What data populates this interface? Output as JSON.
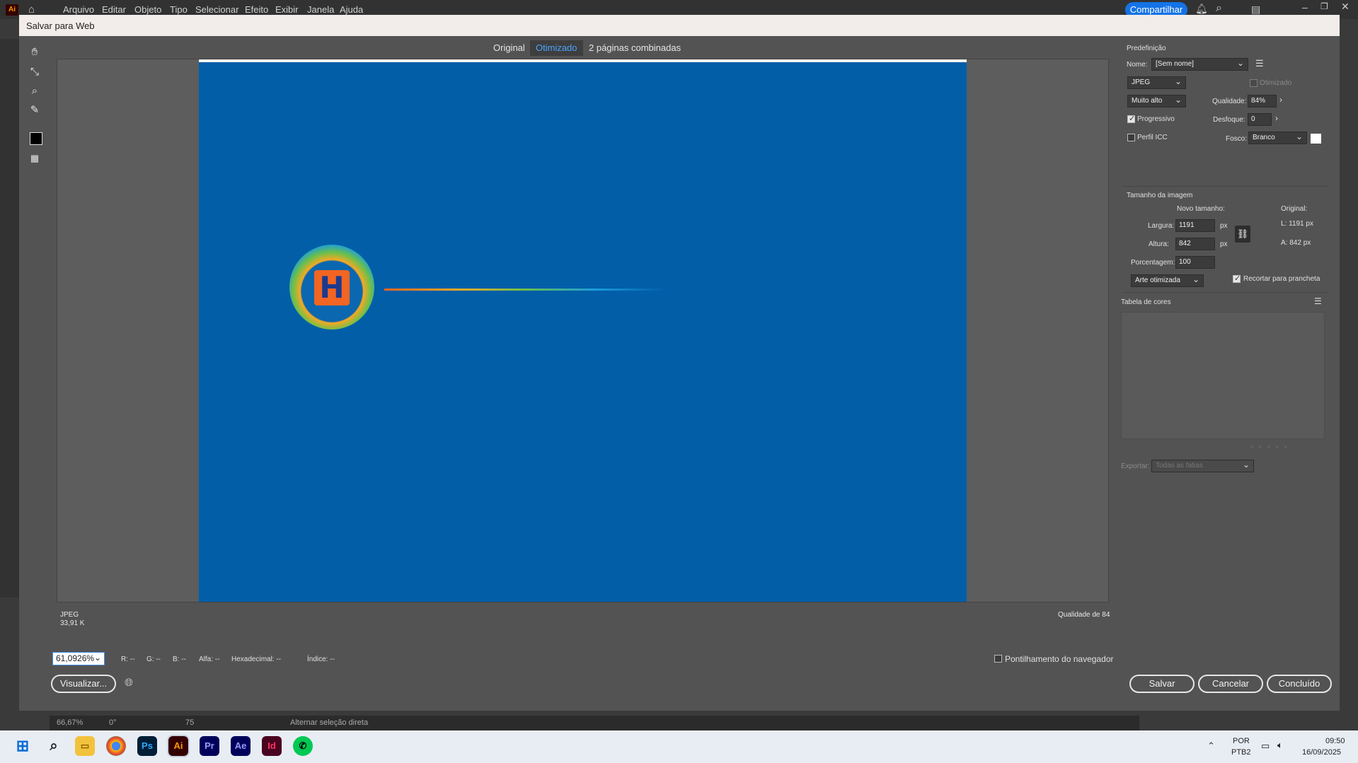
{
  "app": {
    "logo": "Ai",
    "menu": [
      "Arquivo",
      "Editar",
      "Objeto",
      "Tipo",
      "Selecionar",
      "Efeito",
      "Exibir",
      "Janela",
      "Ajuda"
    ],
    "share_label": "Compartilhar"
  },
  "dialog": {
    "title": "Salvar para Web",
    "tabs": [
      "Original",
      "Otimizado",
      "2 páginas combinadas"
    ],
    "active_tab": "Otimizado",
    "canvas_info": {
      "format": "JPEG",
      "size": "33,91 K",
      "quality_note": "Qualidade de 84"
    },
    "zoom_value": "61,0926%",
    "color_readout": {
      "r": "R: --",
      "g": "G: --",
      "b": "B: --",
      "alpha": "Alfa: --",
      "hex": "Hexadecimal: --",
      "index": "Índice: --"
    },
    "browser_dither_label": "Pontilhamento do navegador",
    "preview_label": "Visualizar...",
    "save_label": "Salvar",
    "cancel_label": "Cancelar",
    "done_label": "Concluído"
  },
  "panel": {
    "preset_heading": "Predefinição",
    "name_label": "Nome:",
    "name_value": "[Sem nome]",
    "format_value": "JPEG",
    "optimized_label": "Otimizado",
    "quality_preset": "Muito alto",
    "quality_label": "Qualidade:",
    "quality_value": "84%",
    "progressive_label": "Progressivo",
    "progressive_checked": true,
    "blur_label": "Desfoque:",
    "blur_value": "0",
    "icc_label": "Perfil ICC",
    "icc_checked": false,
    "matte_label": "Fosco:",
    "matte_value": "Branco",
    "image_size_heading": "Tamanho da imagem",
    "new_size_label": "Novo tamanho:",
    "original_label": "Original:",
    "width_label": "Largura:",
    "width_value": "1191",
    "height_label": "Altura:",
    "height_value": "842",
    "px": "px",
    "orig_w": "L:  1191 px",
    "orig_h": "A:  842 px",
    "percent_label": "Porcentagem:",
    "percent_value": "100",
    "resample_value": "Arte otimizada",
    "clip_label": "Recortar para prancheta",
    "clip_checked": true,
    "color_table_heading": "Tabela de cores",
    "export_label": "Exportar:",
    "export_value": "Todas as fatias"
  },
  "status": {
    "zoom": "66,67%",
    "rotation": "0°",
    "page": "75",
    "mode": "Alternar seleção direta"
  },
  "taskbar": {
    "lang": "POR",
    "layout": "PTB2",
    "time": "09:50",
    "date": "16/09/2025",
    "apps": [
      "Ps",
      "Ai",
      "Pr",
      "Ae",
      "Id"
    ]
  }
}
